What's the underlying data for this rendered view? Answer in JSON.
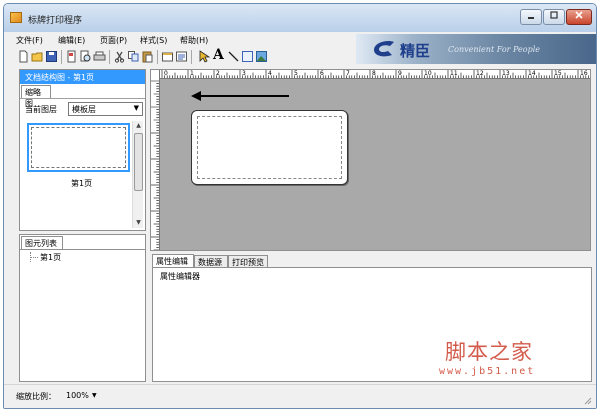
{
  "window": {
    "title": "标牌打印程序"
  },
  "menu": [
    {
      "label": "文件(F)"
    },
    {
      "label": "编辑(E)"
    },
    {
      "label": "页面(P)"
    },
    {
      "label": "样式(S)"
    },
    {
      "label": "帮助(H)"
    }
  ],
  "toolbar": [
    {
      "icon": "new-file-icon"
    },
    {
      "icon": "open-folder-icon"
    },
    {
      "icon": "save-icon"
    },
    {
      "icon": "print-preview-icon"
    },
    {
      "icon": "zoom-page-icon"
    },
    {
      "icon": "print-icon"
    },
    {
      "icon": "cut-icon"
    },
    {
      "icon": "copy-icon"
    },
    {
      "icon": "paste-icon"
    },
    {
      "icon": "page-setup-icon"
    },
    {
      "icon": "properties-icon"
    },
    {
      "icon": "select-pointer-icon"
    },
    {
      "icon": "text-tool-icon",
      "glyph": "A"
    },
    {
      "icon": "line-tool-icon"
    },
    {
      "icon": "rectangle-tool-icon"
    },
    {
      "icon": "image-tool-icon"
    }
  ],
  "banner": {
    "brand": "精臣",
    "slogan": "Convenient For People"
  },
  "left_pane": {
    "header": "文档结构图 - 第1页",
    "thumb_tab": "缩略图",
    "layer_label": "当前图层",
    "layer_value": "模板层",
    "page_label": "第1页"
  },
  "element_pane": {
    "tab": "图元列表",
    "items": [
      "第1页"
    ]
  },
  "ruler": {
    "labels": [
      "0",
      "1",
      "2",
      "3",
      "4",
      "5",
      "6",
      "7",
      "8",
      "9",
      "10",
      "11",
      "12",
      "13",
      "14",
      "15",
      "16"
    ]
  },
  "property_panel": {
    "tabs": [
      {
        "label": "属性编辑",
        "active": true
      },
      {
        "label": "数据源",
        "active": false
      },
      {
        "label": "打印预览",
        "active": false
      }
    ],
    "title": "属性编辑器"
  },
  "status": {
    "zoom_label": "缩放比例：",
    "zoom_value": "100%"
  },
  "watermark": {
    "text": "脚本之家",
    "url": "www.jb51.net"
  }
}
